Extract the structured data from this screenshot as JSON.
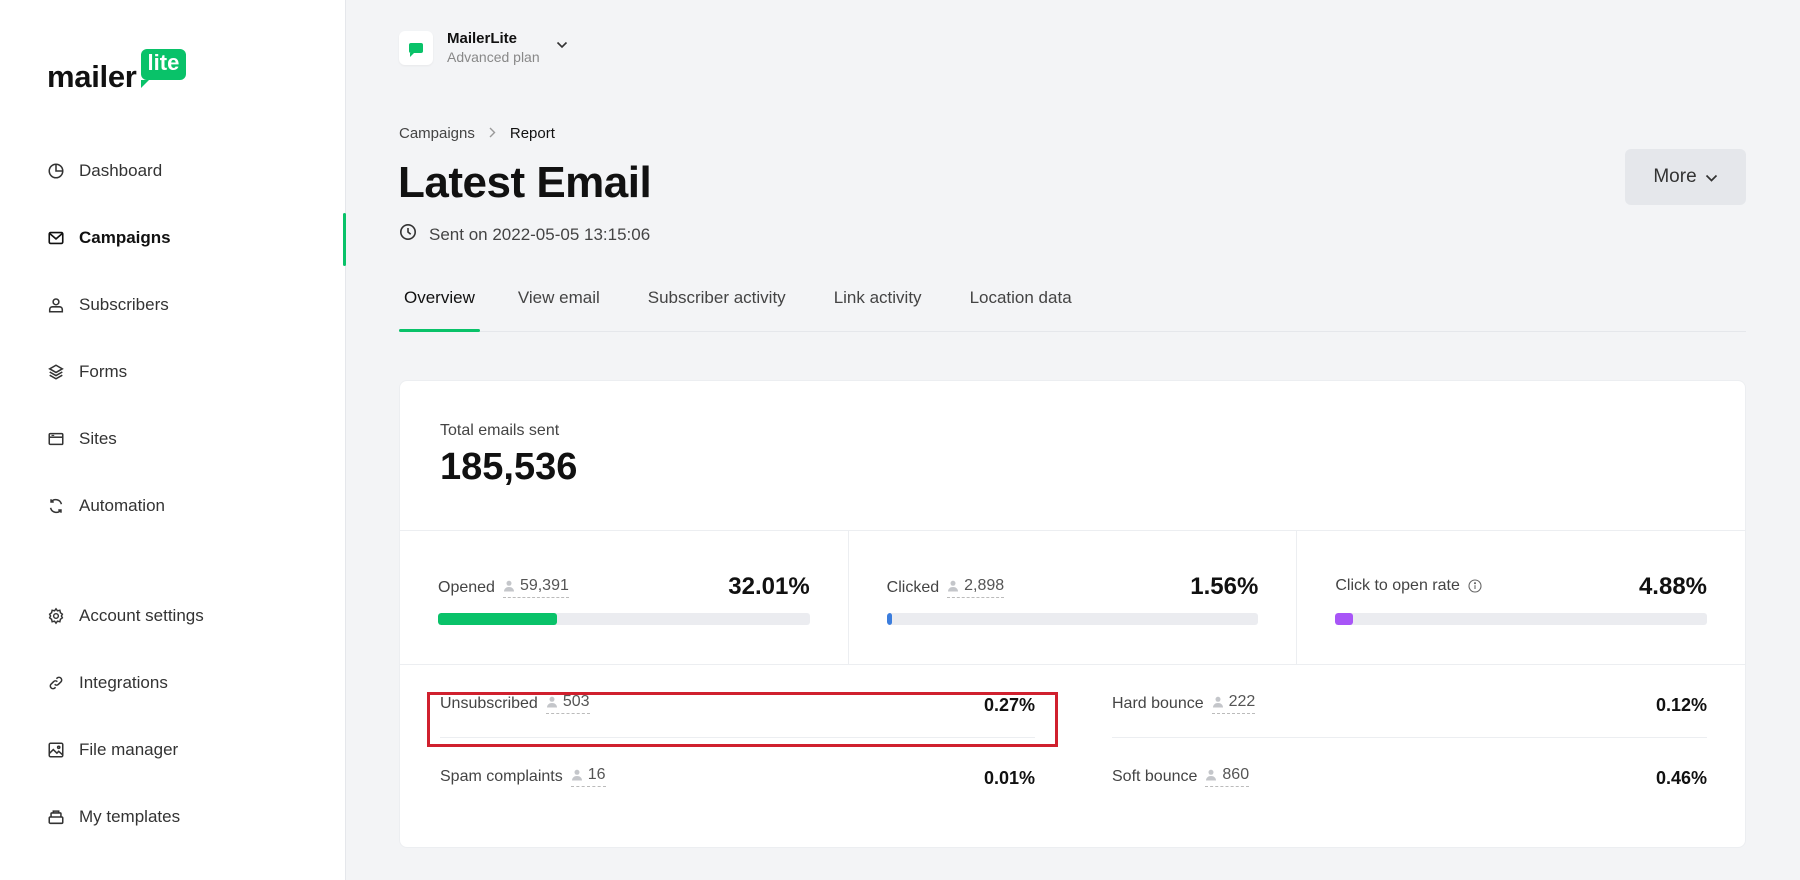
{
  "brand": {
    "logo_text": "mailer",
    "logo_badge": "lite",
    "accent": "#09c269"
  },
  "sidebar": {
    "items": [
      {
        "label": "Dashboard",
        "icon": "pie-chart-icon"
      },
      {
        "label": "Campaigns",
        "icon": "envelope-icon",
        "active": true
      },
      {
        "label": "Subscribers",
        "icon": "user-icon"
      },
      {
        "label": "Forms",
        "icon": "layers-icon"
      },
      {
        "label": "Sites",
        "icon": "browser-icon"
      },
      {
        "label": "Automation",
        "icon": "refresh-icon"
      },
      {
        "label": "Account settings",
        "icon": "gear-icon"
      },
      {
        "label": "Integrations",
        "icon": "link-icon"
      },
      {
        "label": "File manager",
        "icon": "image-icon"
      },
      {
        "label": "My templates",
        "icon": "stack-icon"
      }
    ]
  },
  "account": {
    "name": "MailerLite",
    "plan": "Advanced plan"
  },
  "breadcrumb": {
    "parent": "Campaigns",
    "current": "Report"
  },
  "page": {
    "title": "Latest Email",
    "sent_on": "Sent on 2022-05-05 13:15:06",
    "more_label": "More"
  },
  "tabs": [
    {
      "label": "Overview",
      "active": true
    },
    {
      "label": "View email"
    },
    {
      "label": "Subscriber activity"
    },
    {
      "label": "Link activity"
    },
    {
      "label": "Location data"
    }
  ],
  "report": {
    "total_label": "Total emails sent",
    "total_value": "185,536",
    "stats": [
      {
        "label": "Opened",
        "count": "59,391",
        "percent": "32.01%",
        "fill_percent": 32.01,
        "color": "#09c269"
      },
      {
        "label": "Clicked",
        "count": "2,898",
        "percent": "1.56%",
        "fill_percent": 1.56,
        "color": "#3b7ddd"
      },
      {
        "label": "Click to open rate",
        "count": null,
        "percent": "4.88%",
        "fill_percent": 4.88,
        "color": "#a855f7",
        "info": true
      }
    ],
    "minor": [
      {
        "label": "Unsubscribed",
        "count": "503",
        "percent": "0.27%",
        "highlighted": true
      },
      {
        "label": "Spam complaints",
        "count": "16",
        "percent": "0.01%"
      },
      {
        "label": "Hard bounce",
        "count": "222",
        "percent": "0.12%"
      },
      {
        "label": "Soft bounce",
        "count": "860",
        "percent": "0.46%"
      }
    ]
  }
}
